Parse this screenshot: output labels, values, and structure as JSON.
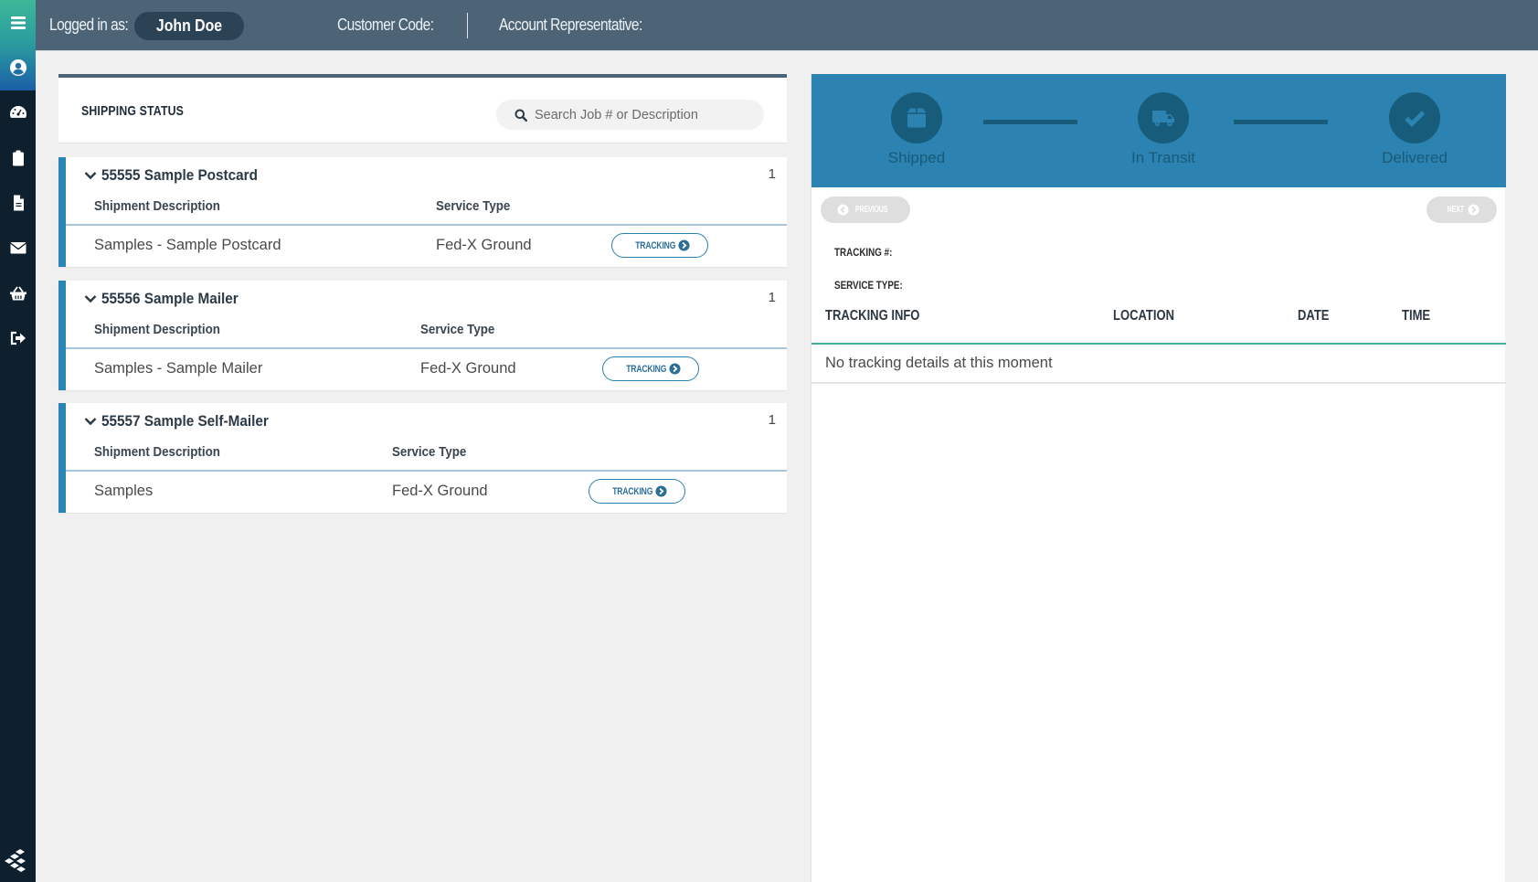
{
  "sidebar": {
    "items": [
      {
        "icon": "menu-icon"
      },
      {
        "icon": "user-circle-icon"
      },
      {
        "icon": "dashboard-gauge-icon"
      },
      {
        "icon": "clipboard-icon"
      },
      {
        "icon": "document-icon"
      },
      {
        "icon": "envelope-icon"
      },
      {
        "icon": "basket-icon"
      },
      {
        "icon": "sign-out-icon"
      }
    ],
    "logo": "layers-logo-icon",
    "gradient_colors": [
      "#3cb898",
      "#1b5fa6"
    ],
    "background": "#0e1f2e"
  },
  "header": {
    "logged_in_label": "Logged in as:",
    "user_name": "John Doe",
    "customer_code_label": "Customer Code:",
    "account_rep_label": "Account Representative:",
    "background": "#4d6476"
  },
  "shipping": {
    "title": "SHIPPING STATUS",
    "search_placeholder": "Search Job # or Description",
    "search_value": "",
    "columns": {
      "description": "Shipment Description",
      "service": "Service Type"
    },
    "tracking_label": "TRACKING",
    "jobs": [
      {
        "title": "55555 Sample Postcard",
        "count": "1",
        "description": "Samples - Sample Postcard",
        "service": "Fed-X Ground"
      },
      {
        "title": "55556 Sample Mailer",
        "count": "1",
        "description": "Samples - Sample Mailer",
        "service": "Fed-X Ground"
      },
      {
        "title": "55557 Sample Self-Mailer",
        "count": "1",
        "description": "Samples",
        "service": "Fed-X Ground"
      }
    ],
    "accent": "#2b84b6"
  },
  "tracking": {
    "steps": [
      {
        "label": "Shipped",
        "icon": "package-box-icon"
      },
      {
        "label": "In Transit",
        "icon": "truck-icon"
      },
      {
        "label": "Delivered",
        "icon": "check-circle-icon"
      }
    ],
    "previous_label": "PREVIOUS",
    "next_label": "NEXT",
    "tracking_number_label": "TRACKING #:",
    "tracking_number_value": "",
    "service_type_label": "SERVICE TYPE:",
    "service_type_value": "",
    "table": {
      "headers": [
        "TRACKING INFO",
        "LOCATION",
        "DATE",
        "TIME"
      ],
      "empty_message": "No tracking details at this moment"
    },
    "band_color": "#2c82b0",
    "step_color": "#185c7c"
  }
}
